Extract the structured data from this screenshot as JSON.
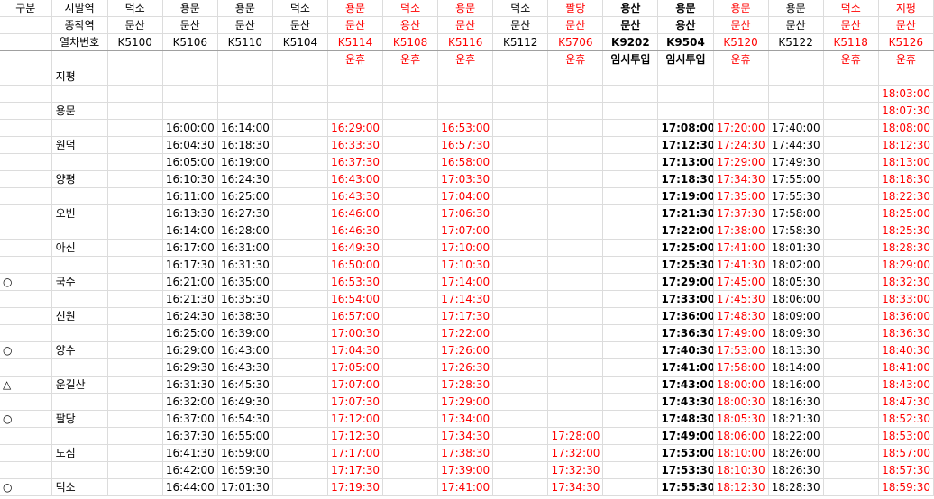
{
  "colors": {
    "red": "#ff0000",
    "black": "#000000",
    "grid": "#dcdcdc"
  },
  "header_rows": [
    {
      "label_col0": "구분",
      "label_col1": "시발역",
      "cells": [
        "덕소",
        "용문",
        "용문",
        "덕소",
        "용문",
        "덕소",
        "용문",
        "덕소",
        "팔당",
        "용산",
        "용문",
        "용문",
        "용문",
        "덕소",
        "지평"
      ]
    },
    {
      "label_col0": "",
      "label_col1": "종착역",
      "cells": [
        "문산",
        "문산",
        "문산",
        "문산",
        "문산",
        "용산",
        "문산",
        "문산",
        "문산",
        "문산",
        "용산",
        "문산",
        "문산",
        "문산",
        "문산"
      ]
    },
    {
      "label_col0": "",
      "label_col1": "열차번호",
      "cells": [
        "K5100",
        "K5106",
        "K5110",
        "K5104",
        "K5114",
        "K5108",
        "K5116",
        "K5112",
        "K5706",
        "K9202",
        "K9504",
        "K5120",
        "K5122",
        "K5118",
        "K5126"
      ]
    }
  ],
  "column_styles": {
    "red": [
      false,
      false,
      false,
      false,
      true,
      true,
      true,
      false,
      true,
      false,
      false,
      true,
      false,
      true,
      true
    ],
    "bold": [
      false,
      false,
      false,
      false,
      false,
      false,
      false,
      false,
      false,
      true,
      true,
      false,
      false,
      false,
      false
    ]
  },
  "notes_row": [
    "",
    "",
    "",
    "",
    "운휴",
    "운휴",
    "운휴",
    "",
    "운휴",
    "임시투입",
    "임시투입",
    "운휴",
    "",
    "운휴",
    "운휴"
  ],
  "rows": [
    {
      "mark": "",
      "station": "지평",
      "times": [
        "",
        "",
        "",
        "",
        "",
        "",
        "",
        "",
        "",
        "",
        "",
        "",
        "",
        "",
        ""
      ]
    },
    {
      "mark": "",
      "station": "",
      "times": [
        "",
        "",
        "",
        "",
        "",
        "",
        "",
        "",
        "",
        "",
        "",
        "",
        "",
        "",
        "18:03:00"
      ]
    },
    {
      "mark": "",
      "station": "용문",
      "times": [
        "",
        "",
        "",
        "",
        "",
        "",
        "",
        "",
        "",
        "",
        "",
        "",
        "",
        "",
        "18:07:30"
      ]
    },
    {
      "mark": "",
      "station": "",
      "times": [
        "",
        "16:00:00",
        "16:14:00",
        "",
        "16:29:00",
        "",
        "16:53:00",
        "",
        "",
        "",
        "17:08:00",
        "17:20:00",
        "17:40:00",
        "",
        "18:08:00"
      ]
    },
    {
      "mark": "",
      "station": "원덕",
      "times": [
        "",
        "16:04:30",
        "16:18:30",
        "",
        "16:33:30",
        "",
        "16:57:30",
        "",
        "",
        "",
        "17:12:30",
        "17:24:30",
        "17:44:30",
        "",
        "18:12:30"
      ]
    },
    {
      "mark": "",
      "station": "",
      "times": [
        "",
        "16:05:00",
        "16:19:00",
        "",
        "16:37:30",
        "",
        "16:58:00",
        "",
        "",
        "",
        "17:13:00",
        "17:29:00",
        "17:49:30",
        "",
        "18:13:00"
      ]
    },
    {
      "mark": "",
      "station": "양평",
      "times": [
        "",
        "16:10:30",
        "16:24:30",
        "",
        "16:43:00",
        "",
        "17:03:30",
        "",
        "",
        "",
        "17:18:30",
        "17:34:30",
        "17:55:00",
        "",
        "18:18:30"
      ]
    },
    {
      "mark": "",
      "station": "",
      "times": [
        "",
        "16:11:00",
        "16:25:00",
        "",
        "16:43:30",
        "",
        "17:04:00",
        "",
        "",
        "",
        "17:19:00",
        "17:35:00",
        "17:55:30",
        "",
        "18:22:30"
      ]
    },
    {
      "mark": "",
      "station": "오빈",
      "times": [
        "",
        "16:13:30",
        "16:27:30",
        "",
        "16:46:00",
        "",
        "17:06:30",
        "",
        "",
        "",
        "17:21:30",
        "17:37:30",
        "17:58:00",
        "",
        "18:25:00"
      ]
    },
    {
      "mark": "",
      "station": "",
      "times": [
        "",
        "16:14:00",
        "16:28:00",
        "",
        "16:46:30",
        "",
        "17:07:00",
        "",
        "",
        "",
        "17:22:00",
        "17:38:00",
        "17:58:30",
        "",
        "18:25:30"
      ]
    },
    {
      "mark": "",
      "station": "아신",
      "times": [
        "",
        "16:17:00",
        "16:31:00",
        "",
        "16:49:30",
        "",
        "17:10:00",
        "",
        "",
        "",
        "17:25:00",
        "17:41:00",
        "18:01:30",
        "",
        "18:28:30"
      ]
    },
    {
      "mark": "",
      "station": "",
      "times": [
        "",
        "16:17:30",
        "16:31:30",
        "",
        "16:50:00",
        "",
        "17:10:30",
        "",
        "",
        "",
        "17:25:30",
        "17:41:30",
        "18:02:00",
        "",
        "18:29:00"
      ]
    },
    {
      "mark": "○",
      "station": "국수",
      "times": [
        "",
        "16:21:00",
        "16:35:00",
        "",
        "16:53:30",
        "",
        "17:14:00",
        "",
        "",
        "",
        "17:29:00",
        "17:45:00",
        "18:05:30",
        "",
        "18:32:30"
      ]
    },
    {
      "mark": "",
      "station": "",
      "times": [
        "",
        "16:21:30",
        "16:35:30",
        "",
        "16:54:00",
        "",
        "17:14:30",
        "",
        "",
        "",
        "17:33:00",
        "17:45:30",
        "18:06:00",
        "",
        "18:33:00"
      ]
    },
    {
      "mark": "",
      "station": "신원",
      "times": [
        "",
        "16:24:30",
        "16:38:30",
        "",
        "16:57:00",
        "",
        "17:17:30",
        "",
        "",
        "",
        "17:36:00",
        "17:48:30",
        "18:09:00",
        "",
        "18:36:00"
      ]
    },
    {
      "mark": "",
      "station": "",
      "times": [
        "",
        "16:25:00",
        "16:39:00",
        "",
        "17:00:30",
        "",
        "17:22:00",
        "",
        "",
        "",
        "17:36:30",
        "17:49:00",
        "18:09:30",
        "",
        "18:36:30"
      ]
    },
    {
      "mark": "○",
      "station": "양수",
      "times": [
        "",
        "16:29:00",
        "16:43:00",
        "",
        "17:04:30",
        "",
        "17:26:00",
        "",
        "",
        "",
        "17:40:30",
        "17:53:00",
        "18:13:30",
        "",
        "18:40:30"
      ]
    },
    {
      "mark": "",
      "station": "",
      "times": [
        "",
        "16:29:30",
        "16:43:30",
        "",
        "17:05:00",
        "",
        "17:26:30",
        "",
        "",
        "",
        "17:41:00",
        "17:58:00",
        "18:14:00",
        "",
        "18:41:00"
      ]
    },
    {
      "mark": "△",
      "station": "운길산",
      "times": [
        "",
        "16:31:30",
        "16:45:30",
        "",
        "17:07:00",
        "",
        "17:28:30",
        "",
        "",
        "",
        "17:43:00",
        "18:00:00",
        "18:16:00",
        "",
        "18:43:00"
      ]
    },
    {
      "mark": "",
      "station": "",
      "times": [
        "",
        "16:32:00",
        "16:49:30",
        "",
        "17:07:30",
        "",
        "17:29:00",
        "",
        "",
        "",
        "17:43:30",
        "18:00:30",
        "18:16:30",
        "",
        "18:47:30"
      ]
    },
    {
      "mark": "○",
      "station": "팔당",
      "times": [
        "",
        "16:37:00",
        "16:54:30",
        "",
        "17:12:00",
        "",
        "17:34:00",
        "",
        "",
        "",
        "17:48:30",
        "18:05:30",
        "18:21:30",
        "",
        "18:52:30"
      ]
    },
    {
      "mark": "",
      "station": "",
      "times": [
        "",
        "16:37:30",
        "16:55:00",
        "",
        "17:12:30",
        "",
        "17:34:30",
        "",
        "17:28:00",
        "",
        "17:49:00",
        "18:06:00",
        "18:22:00",
        "",
        "18:53:00"
      ]
    },
    {
      "mark": "",
      "station": "도심",
      "times": [
        "",
        "16:41:30",
        "16:59:00",
        "",
        "17:17:00",
        "",
        "17:38:30",
        "",
        "17:32:00",
        "",
        "17:53:00",
        "18:10:00",
        "18:26:00",
        "",
        "18:57:00"
      ]
    },
    {
      "mark": "",
      "station": "",
      "times": [
        "",
        "16:42:00",
        "16:59:30",
        "",
        "17:17:30",
        "",
        "17:39:00",
        "",
        "17:32:30",
        "",
        "17:53:30",
        "18:10:30",
        "18:26:30",
        "",
        "18:57:30"
      ]
    },
    {
      "mark": "○",
      "station": "덕소",
      "times": [
        "",
        "16:44:00",
        "17:01:30",
        "",
        "17:19:30",
        "",
        "17:41:00",
        "",
        "17:34:30",
        "",
        "17:55:30",
        "18:12:30",
        "18:28:30",
        "",
        "18:59:30"
      ]
    }
  ]
}
